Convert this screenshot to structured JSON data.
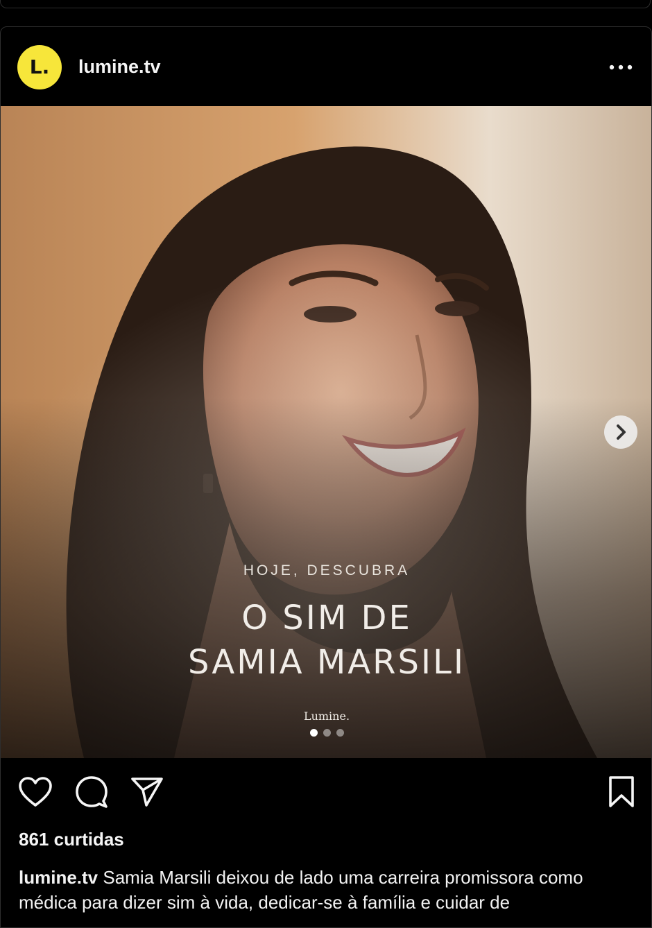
{
  "post": {
    "account": {
      "username": "lumine.tv",
      "avatar_text": "L.",
      "avatar_color": "#f7e63a"
    },
    "more_icon": "more-horizontal-icon",
    "media": {
      "overlay": {
        "kicker": "HOJE, DESCUBRA",
        "title_line1": "O SIM DE",
        "title_line2": "SAMIA MARSILI",
        "brand": "Lumine."
      },
      "carousel": {
        "current": 1,
        "total": 3
      },
      "next_icon": "chevron-right-icon"
    },
    "actions": {
      "like_icon": "heart-icon",
      "comment_icon": "comment-icon",
      "share_icon": "send-icon",
      "save_icon": "bookmark-icon"
    },
    "likes": "861 curtidas",
    "caption": {
      "username": "lumine.tv",
      "text": " Samia Marsili deixou de lado uma carreira promissora como médica para dizer sim à vida, dedicar-se à família e cuidar de"
    }
  }
}
